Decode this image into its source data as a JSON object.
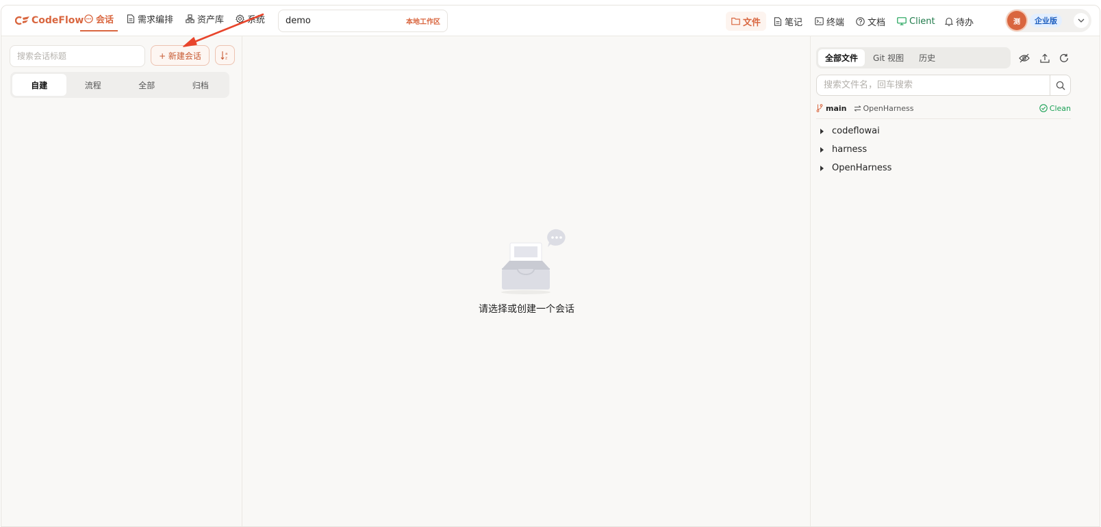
{
  "app": {
    "logo_text": "CodeFlow",
    "brand_color": "#d9663f"
  },
  "nav": {
    "items": [
      {
        "label": "会话",
        "icon": "chat-icon",
        "active": true
      },
      {
        "label": "需求编排",
        "icon": "document-icon"
      },
      {
        "label": "资产库",
        "icon": "assets-icon"
      },
      {
        "label": "系统",
        "icon": "gear-icon"
      }
    ]
  },
  "workspace": {
    "name": "demo",
    "tag": "本地工作区"
  },
  "toolbar": {
    "files": "文件",
    "notes": "笔记",
    "terminal": "终端",
    "docs": "文档",
    "client": "Client",
    "todo": "待办"
  },
  "user": {
    "avatar_text": "测",
    "edition": "企业版"
  },
  "left": {
    "search_placeholder": "搜索会话标题",
    "new_session": "+ 新建会话",
    "tabs": [
      "自建",
      "流程",
      "全部",
      "归档"
    ],
    "active_tab": "自建"
  },
  "center": {
    "empty_text": "请选择或创建一个会话"
  },
  "files": {
    "tabs": [
      "全部文件",
      "Git 视图",
      "历史"
    ],
    "active_tab": "全部文件",
    "search_placeholder": "搜索文件名，回车搜索",
    "branch": "main",
    "repo": "OpenHarness",
    "status": "Clean",
    "status_color": "#1aa055",
    "tree": [
      "codeflowai",
      "harness",
      "OpenHarness"
    ]
  }
}
